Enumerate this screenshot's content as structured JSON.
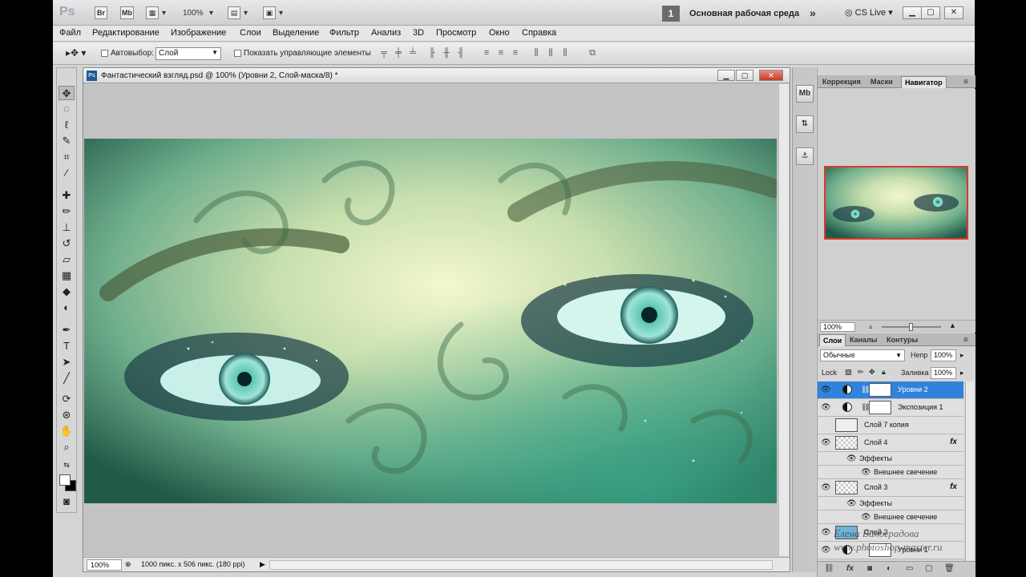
{
  "appbar": {
    "logo": "Ps",
    "bridge": "Br",
    "minibridge": "Mb",
    "zoom": "100%",
    "workspace_num": "1",
    "workspace_name": "Основная рабочая среда",
    "cs_live": "CS Live"
  },
  "menu": [
    "Файл",
    "Редактирование",
    "Изображение",
    "Слои",
    "Выделение",
    "Фильтр",
    "Анализ",
    "3D",
    "Просмотр",
    "Окно",
    "Справка"
  ],
  "options": {
    "autoselect_label": "Автовыбор:",
    "autoselect_value": "Слой",
    "show_controls_label": "Показать управляющие элементы"
  },
  "document": {
    "title": "Фантастический взгляд.psd @ 100% (Уровни 2, Слой-маска/8) *",
    "zoom": "100%",
    "info": "1000 пикс. x 506 пикс. (180 ppi)"
  },
  "right_tabs_top": [
    "Коррекция",
    "Маски",
    "Навигатор"
  ],
  "navigator": {
    "zoom": "100%"
  },
  "right_tabs_layers": [
    "Слои",
    "Каналы",
    "Контуры"
  ],
  "layers_panel": {
    "blend_mode": "Обычные",
    "opacity_label": "Непр",
    "opacity": "100%",
    "lock_label": "Lock",
    "fill_label": "Заливка",
    "fill": "100%",
    "layers": [
      {
        "name": "Уровни 2",
        "selected": true
      },
      {
        "name": "Экспозиция 1"
      },
      {
        "name": "Слой 7 копия"
      },
      {
        "name": "Слой 4",
        "fx": "fx"
      },
      {
        "name": "Эффекты"
      },
      {
        "name": "Внешнее свечение"
      },
      {
        "name": "Слой 3",
        "fx": "fx"
      },
      {
        "name": "Эффекты"
      },
      {
        "name": "Внешнее свечение"
      },
      {
        "name": "Слой 2"
      },
      {
        "name": "Уровни 1"
      }
    ]
  },
  "watermark": {
    "line1": "Елена Виноградова",
    "line2": "www.photoshop-master.ru"
  },
  "colors": {
    "accent_selection": "#2f83dd",
    "nav_frame": "#d83b2b"
  }
}
